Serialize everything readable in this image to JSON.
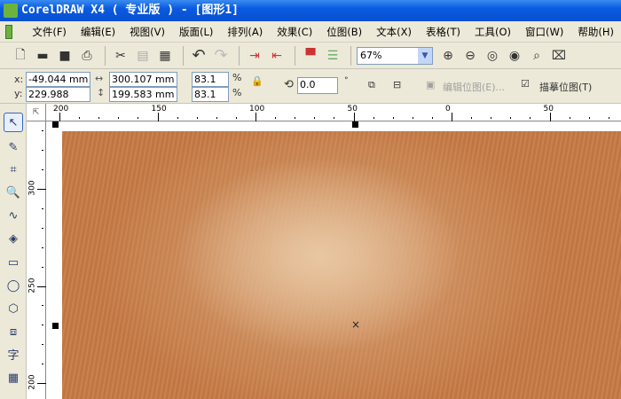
{
  "title": "CorelDRAW X4 ( 专业版 ) - [图形1]",
  "menu": [
    "文件(F)",
    "编辑(E)",
    "视图(V)",
    "版面(L)",
    "排列(A)",
    "效果(C)",
    "位图(B)",
    "文本(X)",
    "表格(T)",
    "工具(O)",
    "窗口(W)",
    "帮助(H)"
  ],
  "toolbar": {
    "zoom": "67%"
  },
  "props": {
    "x_label": "x:",
    "y_label": "y:",
    "x": "-49.044 mm",
    "y": "229.988 mm",
    "width": "300.107 mm",
    "height": "199.583 mm",
    "scale_x": "83.1",
    "scale_y": "83.1",
    "pct": "%",
    "angle": "0.0",
    "deg": "°",
    "edit_bitmap": "编辑位图(E)...",
    "trace_bitmap": "描摹位图(T)"
  },
  "ruler": {
    "top": [
      "200",
      "150",
      "100",
      "50",
      "0",
      "50"
    ],
    "left": [
      "300",
      "250",
      "200"
    ]
  },
  "tools": {
    "text": "字"
  }
}
